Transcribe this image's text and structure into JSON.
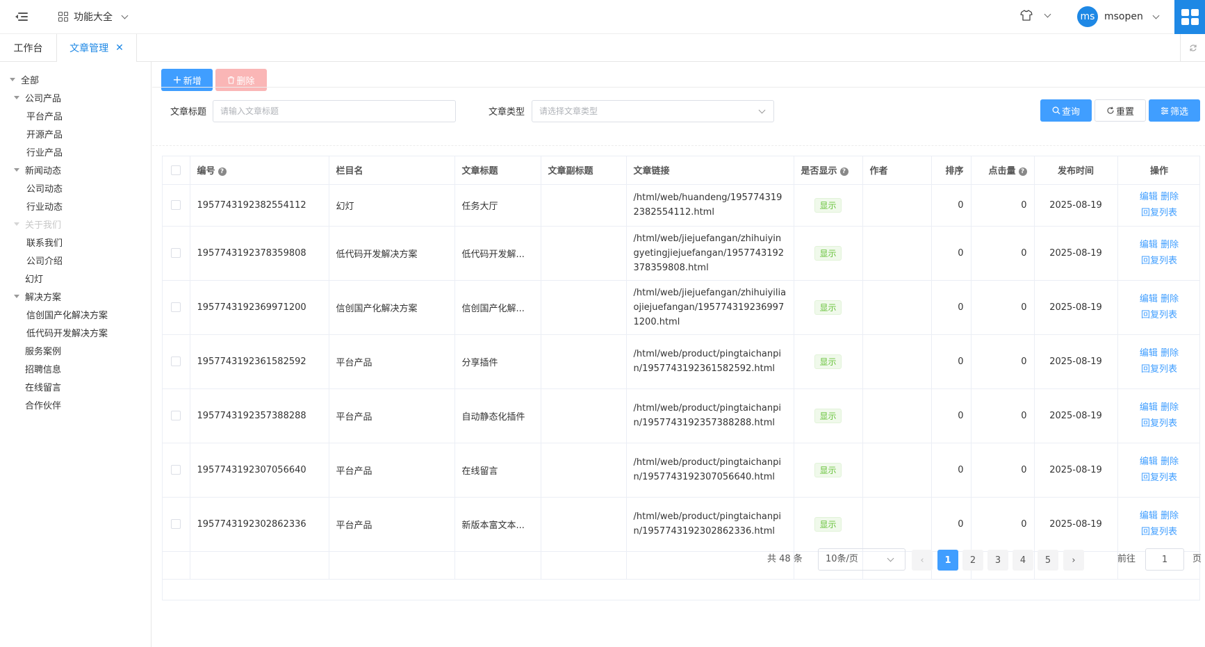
{
  "header": {
    "func_menu_label": "功能大全",
    "avatar_text": "ms",
    "username": "msopen"
  },
  "tabs": [
    {
      "label": "工作台"
    },
    {
      "label": "文章管理",
      "close": "✕"
    }
  ],
  "sidebar": {
    "items": [
      {
        "label": "全部",
        "level": 0,
        "caret": true
      },
      {
        "label": "公司产品",
        "level": 1,
        "caret": true
      },
      {
        "label": "平台产品",
        "level": 2,
        "caret": false
      },
      {
        "label": "开源产品",
        "level": 2,
        "caret": false
      },
      {
        "label": "行业产品",
        "level": 2,
        "caret": false
      },
      {
        "label": "新闻动态",
        "level": 1,
        "caret": true
      },
      {
        "label": "公司动态",
        "level": 2,
        "caret": false
      },
      {
        "label": "行业动态",
        "level": 2,
        "caret": false
      },
      {
        "label": "关于我们",
        "level": 1,
        "caret": true,
        "dim": true
      },
      {
        "label": "联系我们",
        "level": 2,
        "caret": false
      },
      {
        "label": "公司介绍",
        "level": 2,
        "caret": false
      },
      {
        "label": "幻灯",
        "level": 1,
        "caret": false
      },
      {
        "label": "解决方案",
        "level": 1,
        "caret": true
      },
      {
        "label": "信创国产化解决方案",
        "level": 2,
        "caret": false
      },
      {
        "label": "低代码开发解决方案",
        "level": 2,
        "caret": false
      },
      {
        "label": "服务案例",
        "level": 1,
        "caret": false
      },
      {
        "label": "招聘信息",
        "level": 1,
        "caret": false
      },
      {
        "label": "在线留言",
        "level": 1,
        "caret": false
      },
      {
        "label": "合作伙伴",
        "level": 1,
        "caret": false
      }
    ]
  },
  "toolbar": {
    "add_label": "新增",
    "delete_label": "删除"
  },
  "filters": {
    "title_label": "文章标题",
    "title_placeholder": "请输入文章标题",
    "type_label": "文章类型",
    "type_placeholder": "请选择文章类型",
    "query_label": "查询",
    "reset_label": "重置",
    "filter_label": "筛选"
  },
  "table": {
    "columns": [
      "编号",
      "栏目名",
      "文章标题",
      "文章副标题",
      "文章链接",
      "是否显示",
      "作者",
      "排序",
      "点击量",
      "发布时间",
      "操作"
    ],
    "help_mark": "?",
    "rows": [
      {
        "id": "1957743192382554112",
        "category": "幻灯",
        "title": "任务大厅",
        "subtitle": "",
        "link": "/html/web/huandeng/1957743192382554112.html",
        "show": "显示",
        "author": "",
        "sort": "0",
        "clicks": "0",
        "date": "2025-08-19"
      },
      {
        "id": "1957743192378359808",
        "category": "低代码开发解决方案",
        "title": "低代码开发解...",
        "subtitle": "",
        "link": "/html/web/jiejuefangan/zhihuiyingyetingjiejuefangan/1957743192378359808.html",
        "show": "显示",
        "author": "",
        "sort": "0",
        "clicks": "0",
        "date": "2025-08-19"
      },
      {
        "id": "1957743192369971200",
        "category": "信创国产化解决方案",
        "title": "信创国产化解...",
        "subtitle": "",
        "link": "/html/web/jiejuefangan/zhihuiyiliaojiejuefangan/1957743192369971200.html",
        "show": "显示",
        "author": "",
        "sort": "0",
        "clicks": "0",
        "date": "2025-08-19"
      },
      {
        "id": "1957743192361582592",
        "category": "平台产品",
        "title": "分享插件",
        "subtitle": "",
        "link": "/html/web/product/pingtaichanpin/1957743192361582592.html",
        "show": "显示",
        "author": "",
        "sort": "0",
        "clicks": "0",
        "date": "2025-08-19"
      },
      {
        "id": "1957743192357388288",
        "category": "平台产品",
        "title": "自动静态化插件",
        "subtitle": "",
        "link": "/html/web/product/pingtaichanpin/1957743192357388288.html",
        "show": "显示",
        "author": "",
        "sort": "0",
        "clicks": "0",
        "date": "2025-08-19"
      },
      {
        "id": "1957743192307056640",
        "category": "平台产品",
        "title": "在线留言",
        "subtitle": "",
        "link": "/html/web/product/pingtaichanpin/1957743192307056640.html",
        "show": "显示",
        "author": "",
        "sort": "0",
        "clicks": "0",
        "date": "2025-08-19"
      },
      {
        "id": "1957743192302862336",
        "category": "平台产品",
        "title": "新版本富文本...",
        "subtitle": "",
        "link": "/html/web/product/pingtaichanpin/1957743192302862336.html",
        "show": "显示",
        "author": "",
        "sort": "0",
        "clicks": "0",
        "date": "2025-08-19"
      }
    ],
    "actions": {
      "edit": "编辑",
      "delete": "删除",
      "recycle": "回复列表"
    }
  },
  "pagination": {
    "total_text": "共 48 条",
    "page_size": "10条/页",
    "pages": [
      "1",
      "2",
      "3",
      "4",
      "5"
    ],
    "current_page": 1,
    "goto_label": "前往",
    "goto_value": "1",
    "page_unit": "页"
  },
  "colors": {
    "primary": "#409eff",
    "header_accent": "#1e88e5",
    "danger_light": "#fab6b6",
    "success": "#67c23a"
  }
}
